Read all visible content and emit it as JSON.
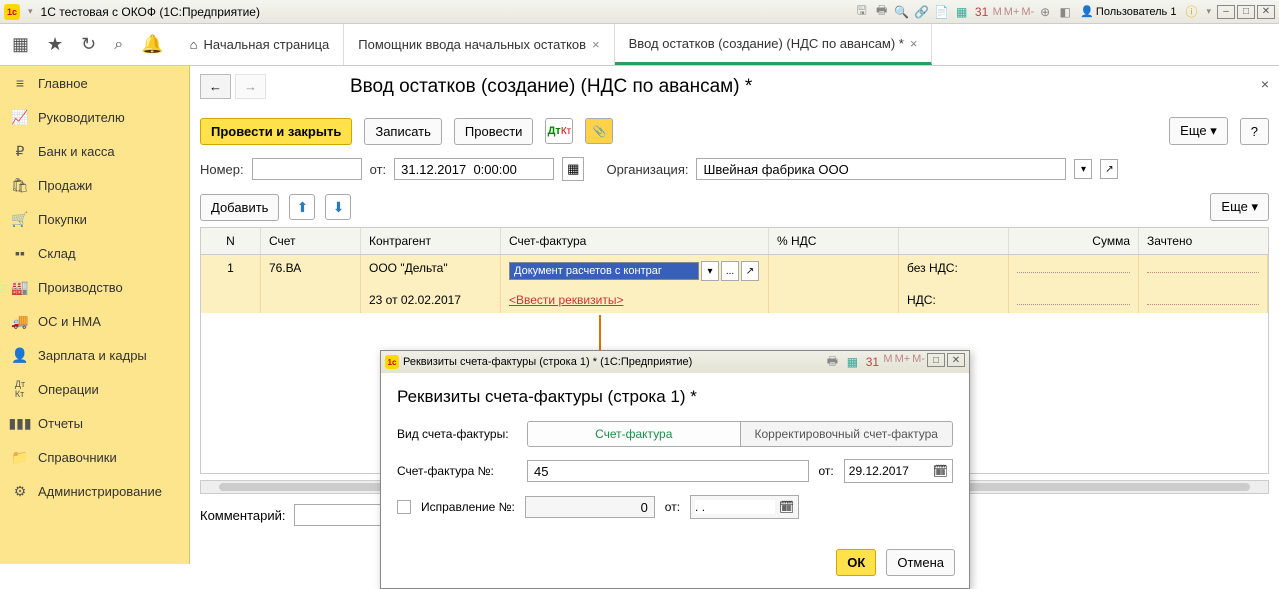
{
  "titlebar": {
    "title": "1С тестовая с ОКОФ  (1С:Предприятие)",
    "user": "Пользователь 1"
  },
  "tabs": {
    "home": "Начальная страница",
    "helper": "Помощник ввода начальных остатков",
    "entry": "Ввод остатков (создание) (НДС по авансам) *"
  },
  "sidebar": {
    "items": [
      "Главное",
      "Руководителю",
      "Банк и касса",
      "Продажи",
      "Покупки",
      "Склад",
      "Производство",
      "ОС и НМА",
      "Зарплата и кадры",
      "Операции",
      "Отчеты",
      "Справочники",
      "Администрирование"
    ]
  },
  "page": {
    "title": "Ввод остатков (создание) (НДС по авансам) *",
    "btn_post_close": "Провести и закрыть",
    "btn_record": "Записать",
    "btn_post": "Провести",
    "btn_more": "Еще",
    "btn_help": "?",
    "lbl_number": "Номер:",
    "lbl_from": "от:",
    "date": "31.12.2017  0:00:00",
    "lbl_org": "Организация:",
    "org": "Швейная фабрика ООО",
    "btn_add": "Добавить",
    "lbl_comment": "Комментарий:"
  },
  "table": {
    "headers": {
      "n": "N",
      "account": "Счет",
      "counterparty": "Контрагент",
      "invoice": "Счет-фактура",
      "vat_pct": "% НДС",
      "sum": "Сумма",
      "paid": "Зачтено"
    },
    "row": {
      "n": "1",
      "account": "76.ВА",
      "counterparty_top": "ООО \"Дельта\"",
      "counterparty_bot": "23 от 02.02.2017",
      "invoice_input": "Документ расчетов с контраг",
      "invoice_link": "<Ввести реквизиты>",
      "vat_top": "без НДС:",
      "vat_bot": "НДС:"
    }
  },
  "dialog": {
    "title": "Реквизиты счета-фактуры (строка 1) *  (1С:Предприятие)",
    "heading": "Реквизиты счета-фактуры (строка 1) *",
    "lbl_type": "Вид счета-фактуры:",
    "opt_invoice": "Счет-фактура",
    "opt_corr": "Корректировочный счет-фактура",
    "lbl_num": "Счет-фактура №:",
    "num": "45",
    "lbl_from": "от:",
    "date": "29.12.2017",
    "lbl_fix": "Исправление №:",
    "fix_num": "0",
    "fix_from": "от:",
    "fix_date": ". .",
    "btn_ok": "ОК",
    "btn_cancel": "Отмена"
  }
}
